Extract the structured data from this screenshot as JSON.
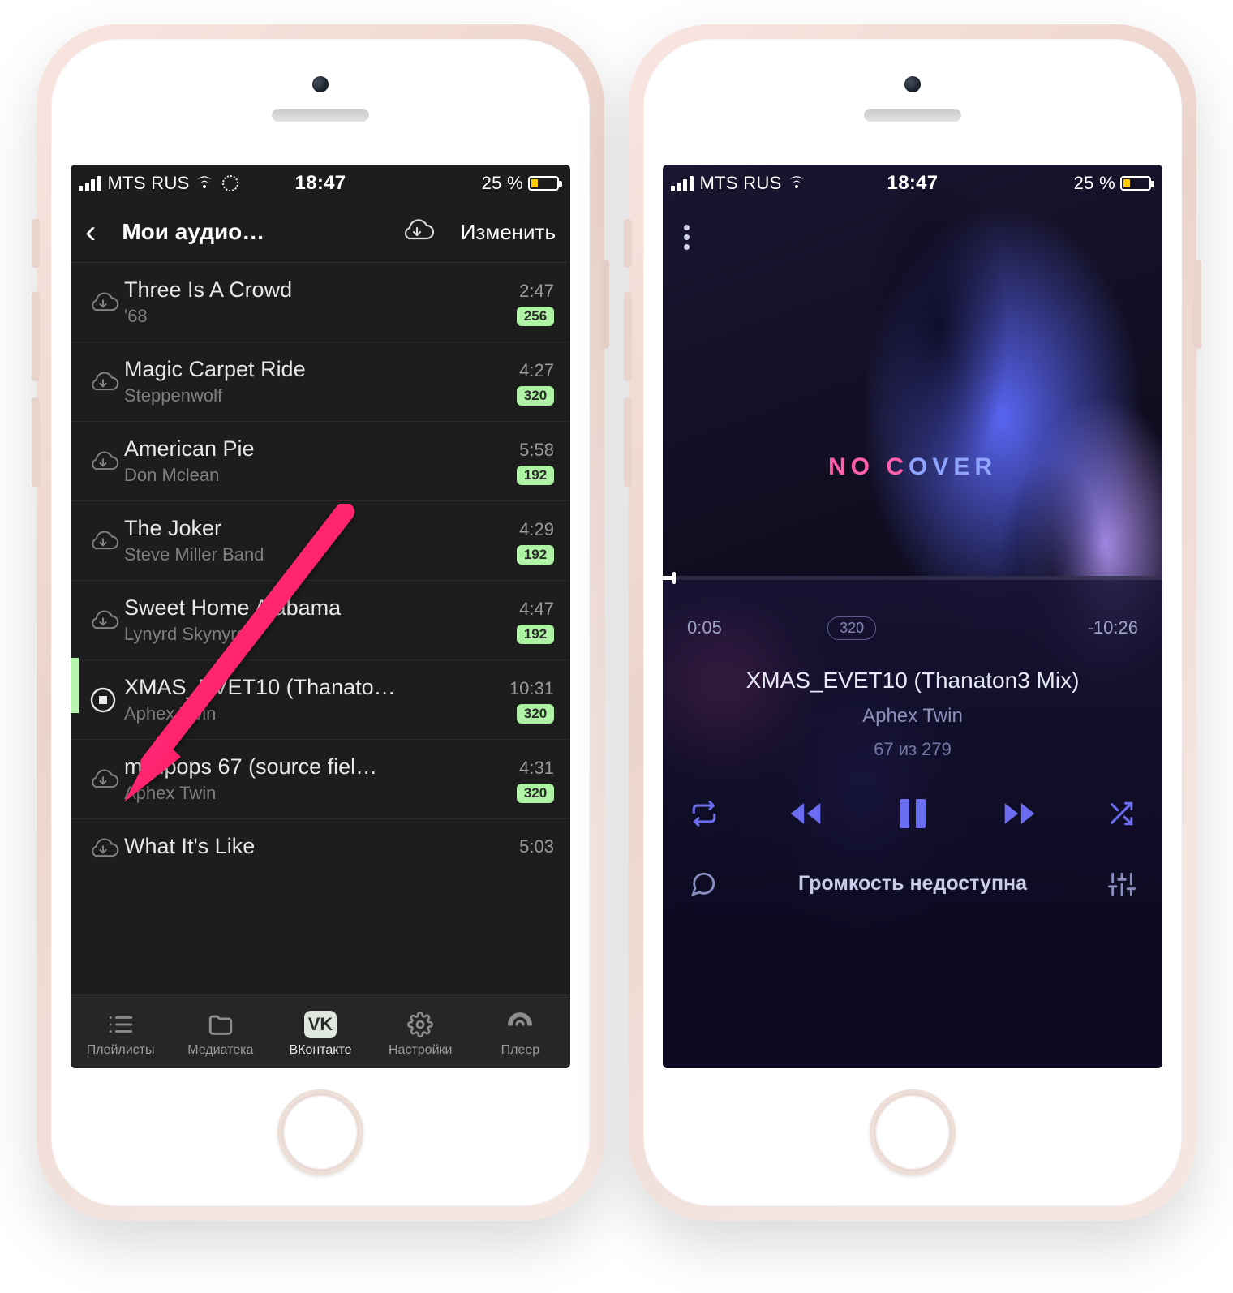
{
  "status": {
    "carrier": "MTS RUS",
    "time": "18:47",
    "battery_text": "25 %"
  },
  "left": {
    "header": {
      "title": "Мои аудио…",
      "edit": "Изменить"
    },
    "tracks": [
      {
        "title": "Three Is A Crowd",
        "artist": "'68",
        "duration": "2:47",
        "bitrate": "256"
      },
      {
        "title": "Magic Carpet Ride",
        "artist": "Steppenwolf",
        "duration": "4:27",
        "bitrate": "320"
      },
      {
        "title": "American Pie",
        "artist": "Don Mclean",
        "duration": "5:58",
        "bitrate": "192"
      },
      {
        "title": "The Joker",
        "artist": "Steve Miller Band",
        "duration": "4:29",
        "bitrate": "192"
      },
      {
        "title": "Sweet Home Alabama",
        "artist": "Lynyrd Skynyrd",
        "duration": "4:47",
        "bitrate": "192"
      },
      {
        "title": "XMAS_EVET10 (Thanato…",
        "artist": "Aphex Twin",
        "duration": "10:31",
        "bitrate": "320"
      },
      {
        "title": "minipops 67 (source fiel…",
        "artist": "Aphex Twin",
        "duration": "4:31",
        "bitrate": "320"
      },
      {
        "title": "What It's Like",
        "artist": "",
        "duration": "5:03",
        "bitrate": ""
      }
    ],
    "playing_index": 5,
    "tabs": [
      {
        "label": "Плейлисты"
      },
      {
        "label": "Медиатека"
      },
      {
        "label": "ВКонтакте"
      },
      {
        "label": "Настройки"
      },
      {
        "label": "Плеер"
      }
    ],
    "active_tab": 2
  },
  "right": {
    "nocover_a": "NO C",
    "nocover_b": "OVER",
    "elapsed": "0:05",
    "remaining": "-10:26",
    "bitrate": "320",
    "title": "XMAS_EVET10 (Thanaton3 Mix)",
    "artist": "Aphex Twin",
    "position": "67 из 279",
    "volume_label": "Громкость недоступна"
  }
}
